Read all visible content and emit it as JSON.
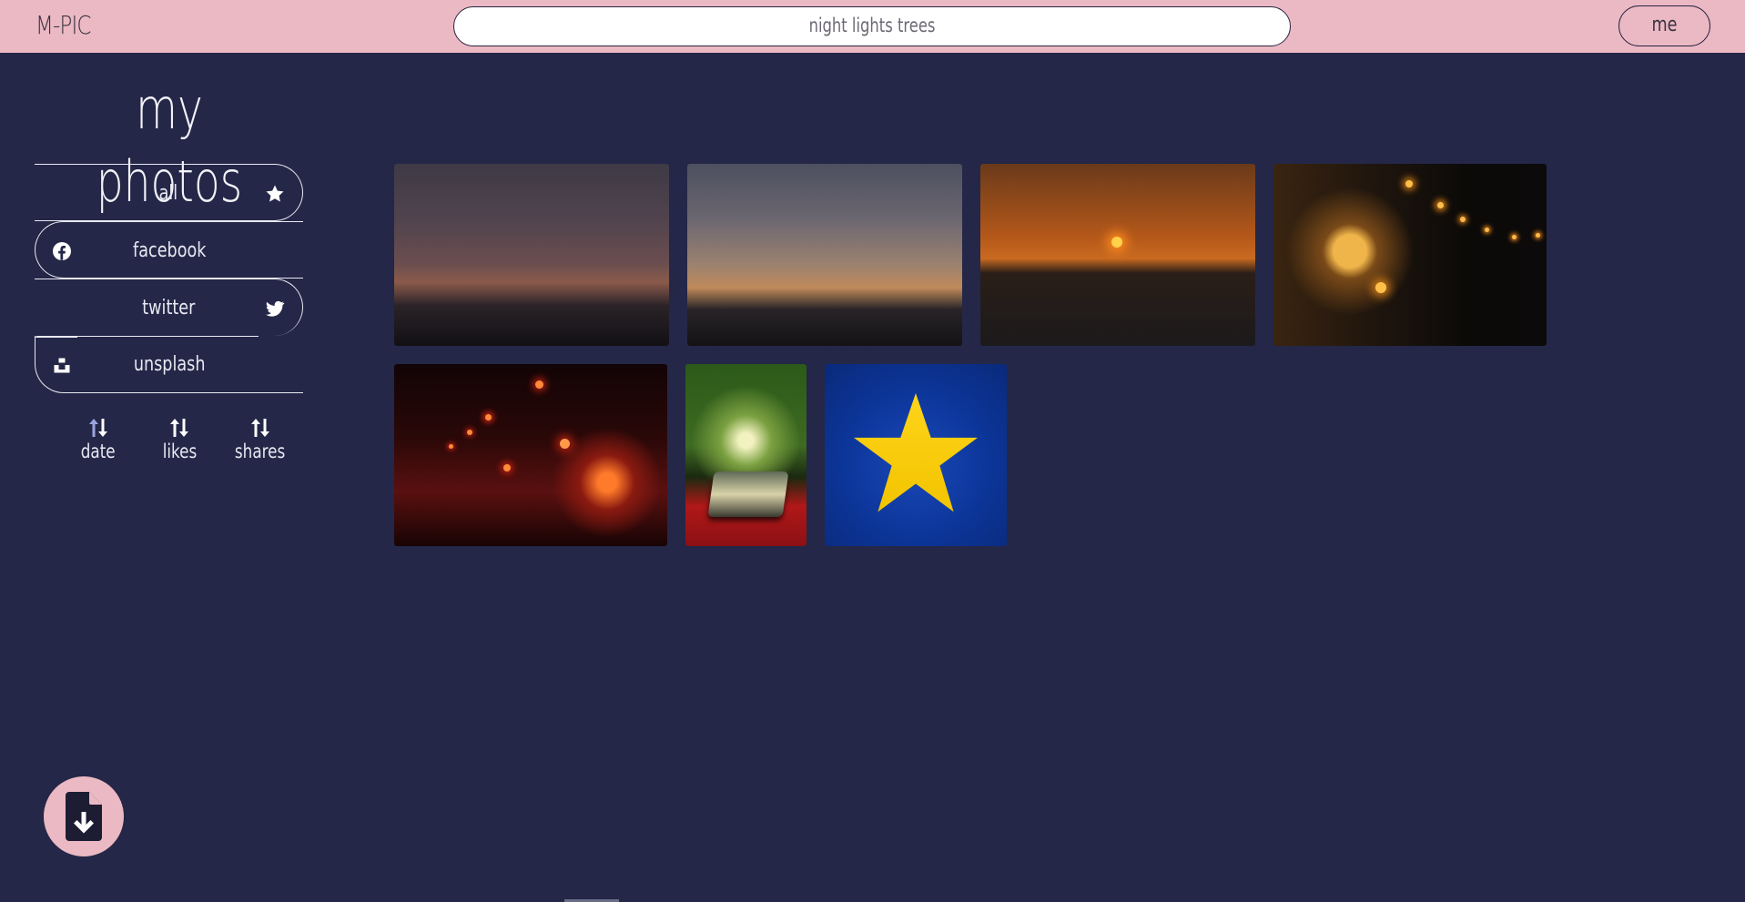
{
  "header": {
    "logo": "M-PIC",
    "search_value": "night lights trees",
    "user_button": "me"
  },
  "sidebar": {
    "title": "my photos",
    "sources": [
      {
        "label": "all",
        "icon": "star-icon"
      },
      {
        "label": "facebook",
        "icon": "facebook-icon"
      },
      {
        "label": "twitter",
        "icon": "twitter-icon"
      },
      {
        "label": "unsplash",
        "icon": "unsplash-icon"
      }
    ],
    "sort_options": [
      {
        "label": "date",
        "icon": "sort-arrows-icon"
      },
      {
        "label": "likes",
        "icon": "sort-arrows-icon"
      },
      {
        "label": "shares",
        "icon": "sort-arrows-icon"
      }
    ]
  },
  "photos": [
    {
      "subject": "sunset clouds over beach"
    },
    {
      "subject": "sunset sky with scattered clouds"
    },
    {
      "subject": "sun setting over sea"
    },
    {
      "subject": "string lights on wooden wall"
    },
    {
      "subject": "red lanterns on dark wall"
    },
    {
      "subject": "sunlit trees reflected in phone"
    },
    {
      "subject": "yellow star on blue"
    }
  ],
  "fab": {
    "icon": "file-download-icon"
  },
  "colors": {
    "background": "#242747",
    "header": "#ebb9c3",
    "text": "#e9e9f2",
    "sort_icon_accent": "#9aa4e0"
  }
}
